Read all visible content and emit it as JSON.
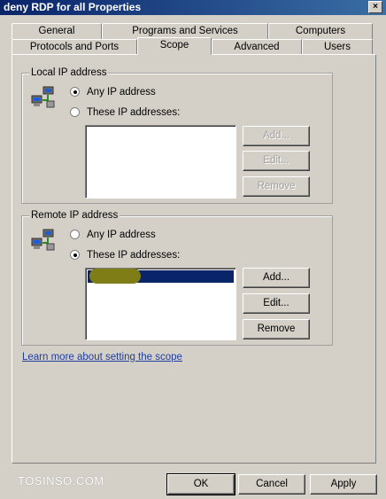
{
  "window": {
    "title": "deny RDP for all Properties",
    "close_glyph": "×"
  },
  "tabs": {
    "row_back": [
      "General",
      "Programs and Services",
      "Computers"
    ],
    "row_front": [
      "Protocols and Ports",
      "Scope",
      "Advanced",
      "Users"
    ],
    "active": "Scope"
  },
  "local": {
    "legend": "Local IP address",
    "icon": "network-computers-icon",
    "option_any": "Any IP address",
    "option_these": "These IP addresses:",
    "selected": "any",
    "entries": [],
    "buttons": {
      "add": "Add...",
      "edit": "Edit...",
      "remove": "Remove"
    }
  },
  "remote": {
    "legend": "Remote IP address",
    "icon": "network-computers-icon",
    "option_any": "Any IP address",
    "option_these": "These IP addresses:",
    "selected": "these",
    "entries": [
      "(redacted)"
    ],
    "buttons": {
      "add": "Add...",
      "edit": "Edit...",
      "remove": "Remove"
    }
  },
  "link": "Learn more about setting the scope",
  "watermark": "TOSINSO.COM",
  "footer": {
    "ok": "OK",
    "cancel": "Cancel",
    "apply": "Apply"
  },
  "colors": {
    "selection": "#0a246a",
    "redaction": "#7f7d16",
    "link": "#1f3ea0"
  }
}
